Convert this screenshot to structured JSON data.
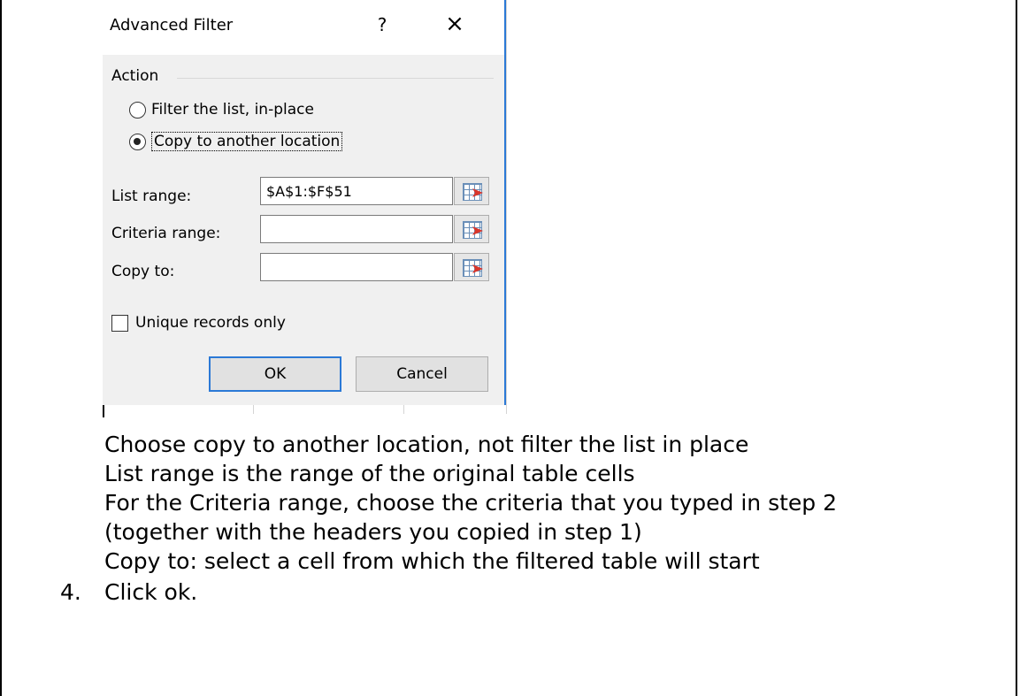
{
  "dialog": {
    "title": "Advanced Filter",
    "help_label": "?",
    "close_label": "×",
    "action_group_label": "Action",
    "radio_options": [
      {
        "label": "Filter the list, in-place",
        "checked": false
      },
      {
        "label": "Copy to another location",
        "checked": true
      }
    ],
    "fields": [
      {
        "label": "List range:",
        "value": "$A$1:$F$51"
      },
      {
        "label": "Criteria range:",
        "value": ""
      },
      {
        "label": "Copy to:",
        "value": ""
      }
    ],
    "unique_records_label": "Unique records only",
    "ok_label": "OK",
    "cancel_label": "Cancel",
    "accent_color": "#2b79d6"
  },
  "instructions": [
    "Choose copy to another location, not filter the list in place",
    "List range is the range of the original table cells",
    "For the Criteria range, choose the criteria that you typed in step 2",
    "(together with the headers you copied in step 1)",
    "Copy to: select a cell from which the filtered table will start"
  ],
  "step": {
    "number": "4.",
    "text": "Click ok."
  }
}
